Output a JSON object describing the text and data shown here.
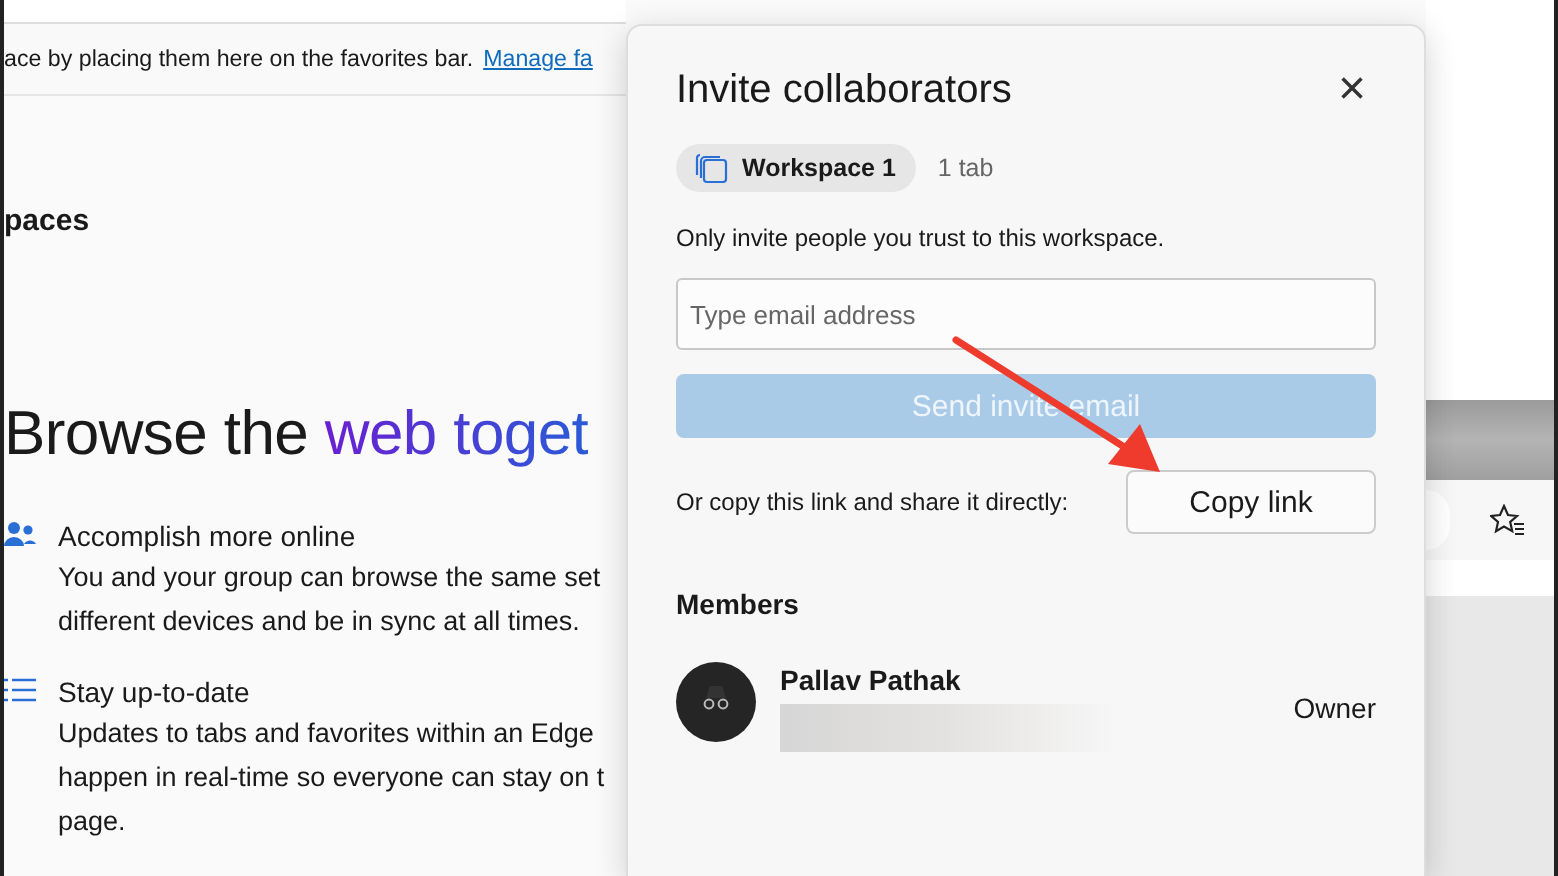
{
  "favorites_bar": {
    "text": "ace by placing them here on the favorites bar.",
    "link": "Manage fa"
  },
  "page": {
    "section_title": "paces",
    "headline": {
      "plain": "Browse the ",
      "accent": "web toget"
    },
    "features": [
      {
        "kind": "people",
        "title": "Accomplish more online",
        "lines": [
          "You and your group can browse the same set",
          "different devices and be in sync at all times."
        ]
      },
      {
        "kind": "list",
        "title": "Stay up-to-date",
        "lines": [
          "Updates to tabs and favorites within an Edge",
          "happen in real-time so everyone can stay on t",
          "page."
        ]
      }
    ]
  },
  "dialog": {
    "title": "Invite collaborators",
    "close": "×",
    "workspace": {
      "name": "Workspace 1",
      "tabs": "1 tab"
    },
    "notice": "Only invite people you trust to this workspace.",
    "email": {
      "placeholder": "Type email address"
    },
    "send_button": {
      "label": "Send invite email",
      "disabled": true
    },
    "copy_prompt": "Or copy this link and share it directly:",
    "copy_button": "Copy link",
    "members_heading": "Members",
    "members": [
      {
        "name": "Pallav Pathak",
        "role": "Owner"
      }
    ]
  }
}
